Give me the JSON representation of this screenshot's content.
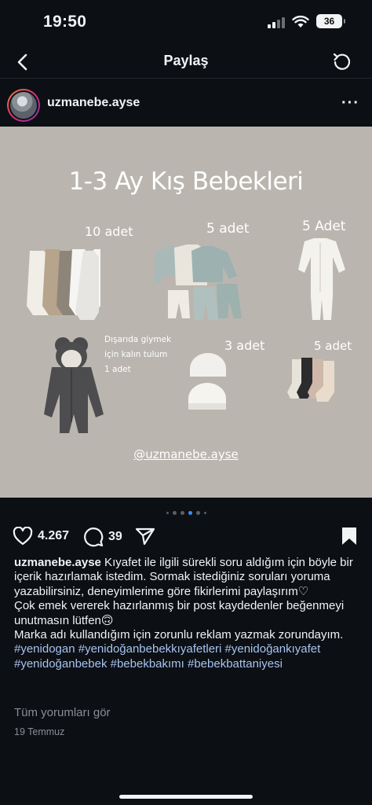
{
  "status": {
    "time": "19:50",
    "battery": "36"
  },
  "nav": {
    "title": "Paylaş"
  },
  "post": {
    "username": "uzmanebe.ayse",
    "image": {
      "title": "1-3 Ay  Kış Bebekleri",
      "labels": {
        "bodysuit": "10 adet",
        "sets": "5 adet",
        "sleepsuit": "5 Adet",
        "hats": "3 adet",
        "socks": "5 adet"
      },
      "note_lines": [
        "Dışarıda giymek",
        "için kalın tulum",
        "1 adet"
      ],
      "handle": "@uzmanebe.ayse",
      "colors": {
        "background": "#bab6af",
        "text": "#ffffff"
      }
    },
    "carousel": {
      "count": 6,
      "active": 3
    },
    "likes": "4.267",
    "comment_count": "39",
    "caption": {
      "username": "uzmanebe.ayse",
      "text1": " Kıyafet ile ilgili sürekli soru aldığım için böyle bir içerik hazırlamak istedim. Sormak istediğiniz soruları yoruma yazabilirsiniz, deneyimlerime göre fikirlerimi paylaşırım♡",
      "text2": "Çok emek vererek hazırlanmış bir post kaydedenler beğenmeyi unutmasın lütfen🙃",
      "text3": "Marka adı kullandığım için zorunlu reklam yazmak zorundayım.",
      "hashtags": "#yenidogan #yenidoğanbebekkıyafetleri #yenidoğankıyafet #yenidoğanbebek #bebekbakımı #bebekbattaniyesi"
    },
    "view_comments": "Tüm yorumları gör",
    "date": "19 Temmuz"
  },
  "icons": [
    "back-icon",
    "refresh-icon",
    "more-icon",
    "heart-icon",
    "comment-icon",
    "share-icon",
    "bookmark-icon",
    "signal-icon",
    "wifi-icon"
  ],
  "accent_color": "#3b8cf6",
  "hashtag_color": "#a6c4ef"
}
